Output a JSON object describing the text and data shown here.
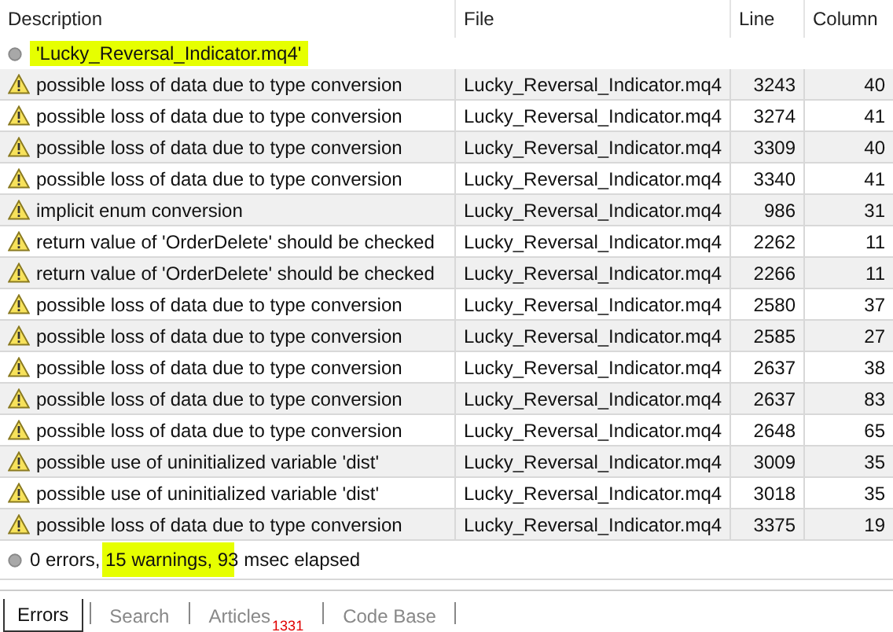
{
  "table": {
    "columns": [
      "Description",
      "File",
      "Line",
      "Column"
    ],
    "group": {
      "title": "'Lucky_Reversal_Indicator.mq4'",
      "highlighted": true
    },
    "rows": [
      {
        "kind": "warning",
        "description": "possible loss of data due to type conversion",
        "file": "Lucky_Reversal_Indicator.mq4",
        "line": "3243",
        "column": "40"
      },
      {
        "kind": "warning",
        "description": "possible loss of data due to type conversion",
        "file": "Lucky_Reversal_Indicator.mq4",
        "line": "3274",
        "column": "41"
      },
      {
        "kind": "warning",
        "description": "possible loss of data due to type conversion",
        "file": "Lucky_Reversal_Indicator.mq4",
        "line": "3309",
        "column": "40"
      },
      {
        "kind": "warning",
        "description": "possible loss of data due to type conversion",
        "file": "Lucky_Reversal_Indicator.mq4",
        "line": "3340",
        "column": "41"
      },
      {
        "kind": "warning",
        "description": "implicit enum conversion",
        "file": "Lucky_Reversal_Indicator.mq4",
        "line": "986",
        "column": "31"
      },
      {
        "kind": "warning",
        "description": "return value of 'OrderDelete' should be checked",
        "file": "Lucky_Reversal_Indicator.mq4",
        "line": "2262",
        "column": "11"
      },
      {
        "kind": "warning",
        "description": "return value of 'OrderDelete' should be checked",
        "file": "Lucky_Reversal_Indicator.mq4",
        "line": "2266",
        "column": "11"
      },
      {
        "kind": "warning",
        "description": "possible loss of data due to type conversion",
        "file": "Lucky_Reversal_Indicator.mq4",
        "line": "2580",
        "column": "37"
      },
      {
        "kind": "warning",
        "description": "possible loss of data due to type conversion",
        "file": "Lucky_Reversal_Indicator.mq4",
        "line": "2585",
        "column": "27"
      },
      {
        "kind": "warning",
        "description": "possible loss of data due to type conversion",
        "file": "Lucky_Reversal_Indicator.mq4",
        "line": "2637",
        "column": "38"
      },
      {
        "kind": "warning",
        "description": "possible loss of data due to type conversion",
        "file": "Lucky_Reversal_Indicator.mq4",
        "line": "2637",
        "column": "83"
      },
      {
        "kind": "warning",
        "description": "possible loss of data due to type conversion",
        "file": "Lucky_Reversal_Indicator.mq4",
        "line": "2648",
        "column": "65"
      },
      {
        "kind": "warning",
        "description": "possible use of uninitialized variable 'dist'",
        "file": "Lucky_Reversal_Indicator.mq4",
        "line": "3009",
        "column": "35"
      },
      {
        "kind": "warning",
        "description": "possible use of uninitialized variable 'dist'",
        "file": "Lucky_Reversal_Indicator.mq4",
        "line": "3018",
        "column": "35"
      },
      {
        "kind": "warning",
        "description": "possible loss of data due to type conversion",
        "file": "Lucky_Reversal_Indicator.mq4",
        "line": "3375",
        "column": "19"
      }
    ],
    "summary": {
      "text": "0 errors, 15 warnings, 93 msec elapsed",
      "highlighted": true
    }
  },
  "tabs": [
    {
      "label": "Errors",
      "selected": true
    },
    {
      "label": "Search",
      "selected": false
    },
    {
      "label": "Articles",
      "selected": false,
      "badge": "1331"
    },
    {
      "label": "Code Base",
      "selected": false
    }
  ]
}
